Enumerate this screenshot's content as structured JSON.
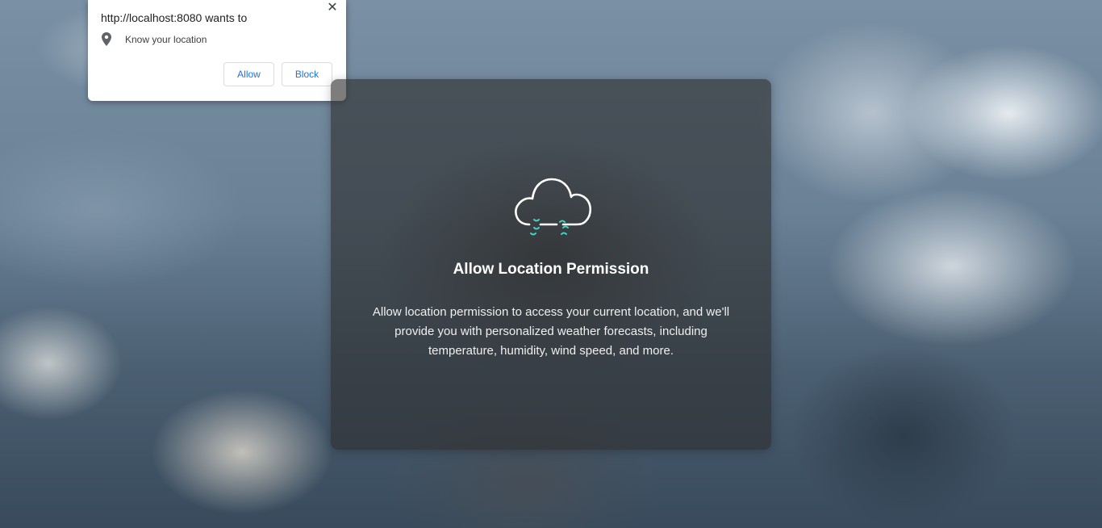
{
  "permission_prompt": {
    "title": "http://localhost:8080 wants to",
    "request_icon": "location-pin-icon",
    "request_text": "Know your location",
    "allow_label": "Allow",
    "block_label": "Block",
    "close_icon": "close-icon",
    "close_glyph": "✕",
    "button_text_color": "#1a73e8"
  },
  "card": {
    "icon": "cloud-rain-icon",
    "title": "Allow Location Permission",
    "description": "Allow location permission to access your current location, and we'll provide you with personalized weather forecasts, including temperature, humidity, wind speed, and more.",
    "icon_accent_color": "#40d6c6"
  }
}
